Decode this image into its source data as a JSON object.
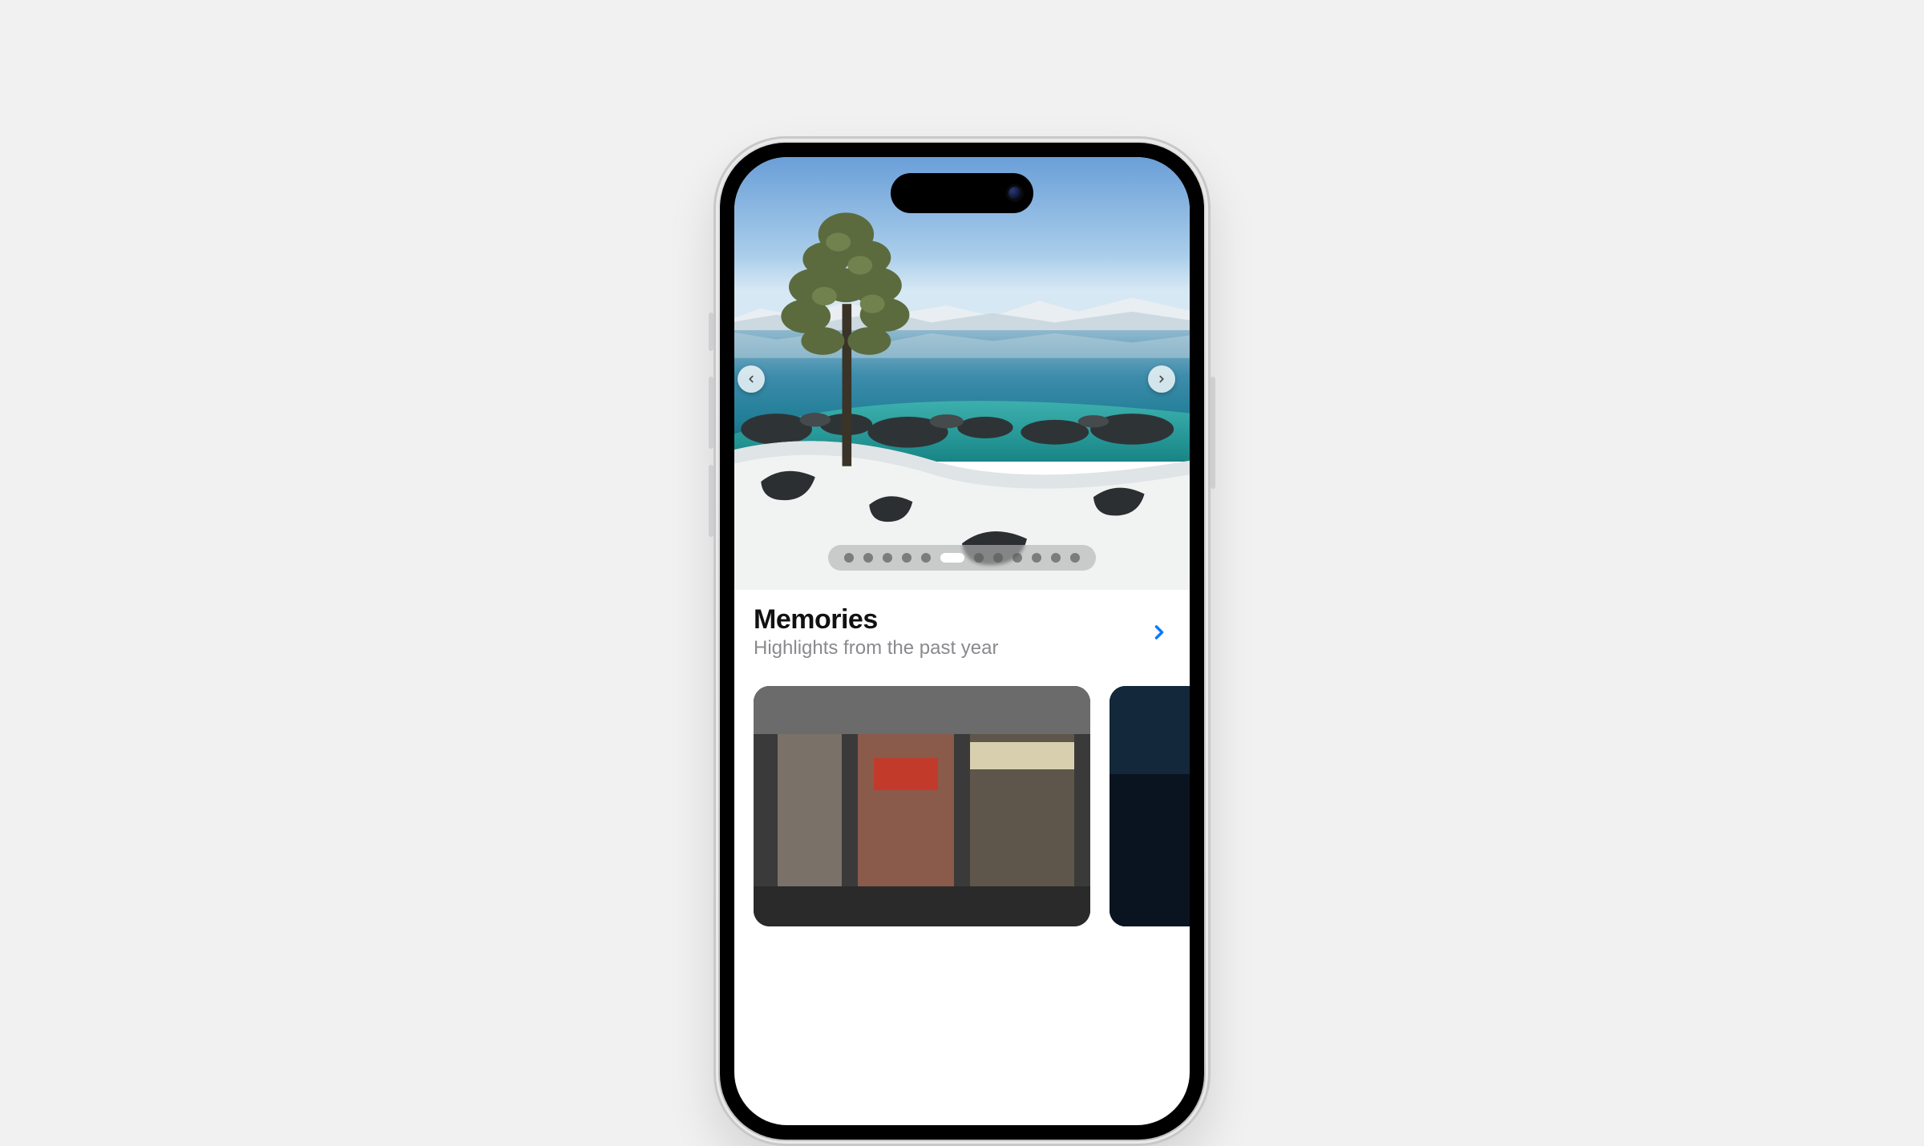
{
  "hero": {
    "icon_prev": "chevron-left-icon",
    "icon_next": "chevron-right-icon",
    "page_count": 12,
    "active_page_index": 5
  },
  "memories": {
    "title": "Memories",
    "subtitle": "Highlights from the past year",
    "more_icon": "chevron-right-icon"
  },
  "colors": {
    "accent": "#0a7aff",
    "page_bg": "#f1f1f2"
  }
}
